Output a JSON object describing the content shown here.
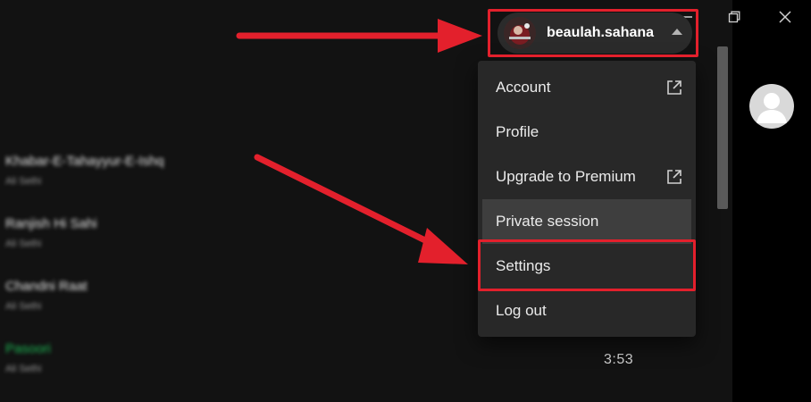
{
  "user": {
    "name": "beaulah.sahana"
  },
  "menu": {
    "items": [
      {
        "label": "Account",
        "external": true
      },
      {
        "label": "Profile",
        "external": false
      },
      {
        "label": "Upgrade to Premium",
        "external": true
      },
      {
        "label": "Private session",
        "external": false
      },
      {
        "label": "Settings",
        "external": false
      },
      {
        "label": "Log out",
        "external": false
      }
    ]
  },
  "tracks": [
    {
      "title": "Khabar-E-Tahayyur-E-Ishq",
      "artist": "Ali Sethi"
    },
    {
      "title": "Ranjish Hi Sahi",
      "artist": "Ali Sethi"
    },
    {
      "title": "Chandni Raat",
      "artist": "Ali Sethi"
    },
    {
      "title": "Pasoori",
      "artist": "Ali Sethi"
    }
  ],
  "now_playing_duration": "3:53",
  "colors": {
    "background": "#121212",
    "menu_bg": "#282828",
    "highlight": "#e3202c",
    "accent_green": "#1db954"
  }
}
